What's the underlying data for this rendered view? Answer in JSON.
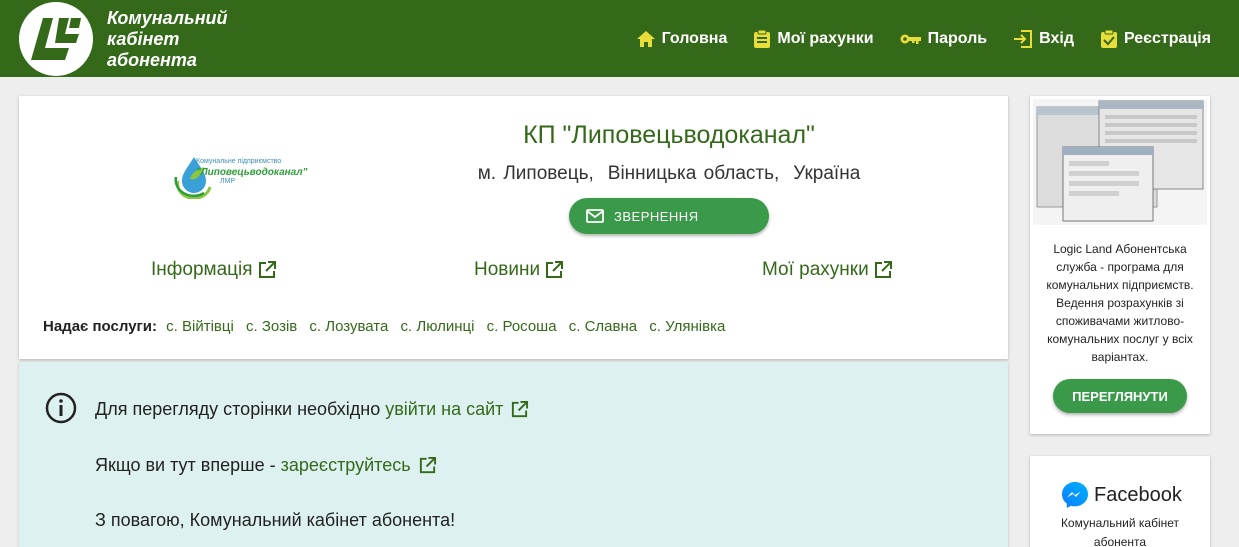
{
  "header": {
    "brand_lines": [
      "Комунальний",
      "кабінет",
      "абонента"
    ],
    "nav": [
      {
        "icon": "home-icon",
        "label": "Головна"
      },
      {
        "icon": "clipboard-icon",
        "label": "Мої рахунки"
      },
      {
        "icon": "key-icon",
        "label": "Пароль"
      },
      {
        "icon": "login-icon",
        "label": "Вхід"
      },
      {
        "icon": "clipboard-check-icon",
        "label": "Реєстрація"
      }
    ]
  },
  "org": {
    "logo_small": "Комунальне підприємство",
    "logo_name": "\"Липовецьводоканал\"",
    "logo_sub": "ЛМР",
    "title": "КП \"Липовецьводоканал\"",
    "location": [
      "м. Липовець,",
      "Вінницька область,",
      "Україна"
    ],
    "appeal_button": "ЗВЕРНЕННЯ",
    "links": [
      "Інформація",
      "Новини",
      "Мої рахунки"
    ],
    "services_label": "Надає послуги:",
    "services": [
      "с. Війтівці",
      "с. Зозів",
      "с. Лозувата",
      "с. Люлинці",
      "с. Росоша",
      "с. Славна",
      "с. Улянівка"
    ]
  },
  "info": {
    "line1_text": "Для перегляду сторінки необхідно",
    "line1_link": "увійти на сайт",
    "line2_text": "Якщо ви тут вперше -",
    "line2_link": "зареєструйтесь",
    "line3_text": "З повагою, Комунальний кабінет абонента!"
  },
  "sidebar": {
    "description": "Logic Land Абонентська служба - програма для комунальних підприємств. Ведення розрахунків зі споживачами житлово-комунальних послуг у всіх варіантах.",
    "view_button": "ПЕРЕГЛЯНУТИ",
    "fb_title": "Facebook",
    "fb_text": "Комунальний кабінет абонента"
  },
  "colors": {
    "header_bg": "#35691a",
    "accent_green": "#3a9a4a",
    "link_green": "#35691a",
    "info_bg": "#def1f1",
    "nav_icon_yellow": "#e8dd3a"
  }
}
